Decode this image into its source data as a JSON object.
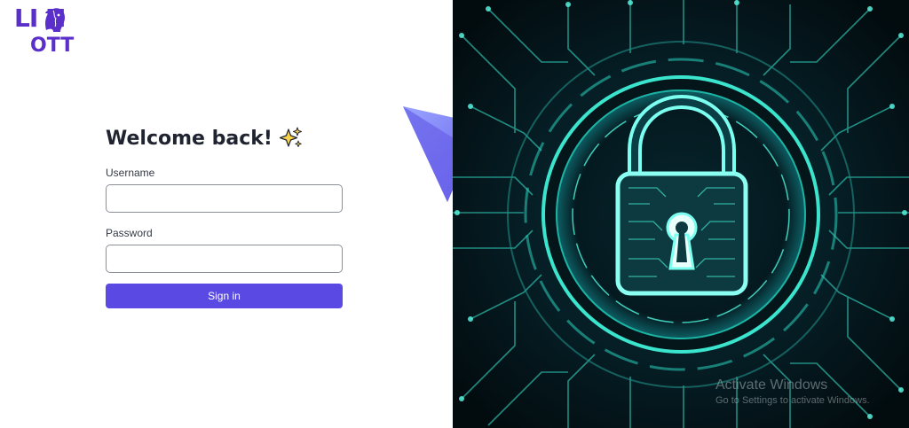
{
  "brand": {
    "logo_top": "LI N",
    "logo_bottom": "OTT",
    "color": "#5b2fc9"
  },
  "form": {
    "title": "Welcome back!",
    "title_icon": "sparkles-icon",
    "username_label": "Username",
    "username_value": "",
    "password_label": "Password",
    "password_value": "",
    "submit_label": "Sign in",
    "accent": "#5a4ae3"
  },
  "hero": {
    "image": "circuit-padlock-illustration",
    "glow_color": "#34e0c8"
  },
  "watermark": {
    "title": "Activate Windows",
    "subtitle": "Go to Settings to activate Windows."
  }
}
